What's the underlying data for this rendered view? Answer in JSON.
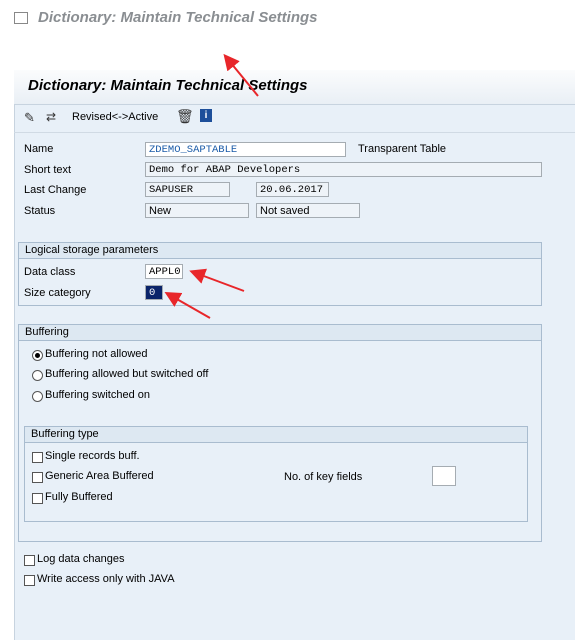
{
  "window": {
    "title": "Dictionary: Maintain Technical Settings"
  },
  "header": {
    "title": "Dictionary: Maintain Technical Settings"
  },
  "app_toolbar": {
    "revised_active_label": "Revised<->Active"
  },
  "fields": {
    "name": {
      "label": "Name",
      "value": "ZDEMO_SAPTABLE",
      "type": "Transparent Table"
    },
    "short_text": {
      "label": "Short text",
      "value": "Demo for ABAP Developers"
    },
    "last_change": {
      "label": "Last Change",
      "user": "SAPUSER",
      "date": "20.06.2017"
    },
    "status": {
      "label": "Status",
      "value": "New",
      "save_state": "Not saved"
    }
  },
  "logical_storage": {
    "title": "Logical storage parameters",
    "data_class_label": "Data class",
    "data_class_value": "APPL0",
    "size_category_label": "Size category",
    "size_category_value": "0"
  },
  "buffering": {
    "title": "Buffering",
    "options": [
      "Buffering not allowed",
      "Buffering allowed but switched off",
      "Buffering switched on"
    ],
    "selected_index": 0,
    "type_title": "Buffering type",
    "type_options": [
      "Single records buff.",
      "Generic Area Buffered",
      "Fully Buffered"
    ],
    "key_fields_label": "No. of key fields",
    "key_fields_value": ""
  },
  "checkboxes": {
    "log_changes": "Log data changes",
    "write_java": "Write access only with JAVA"
  },
  "colors": {
    "arrow": "#e8262a",
    "accent": "#1a5ba8"
  }
}
